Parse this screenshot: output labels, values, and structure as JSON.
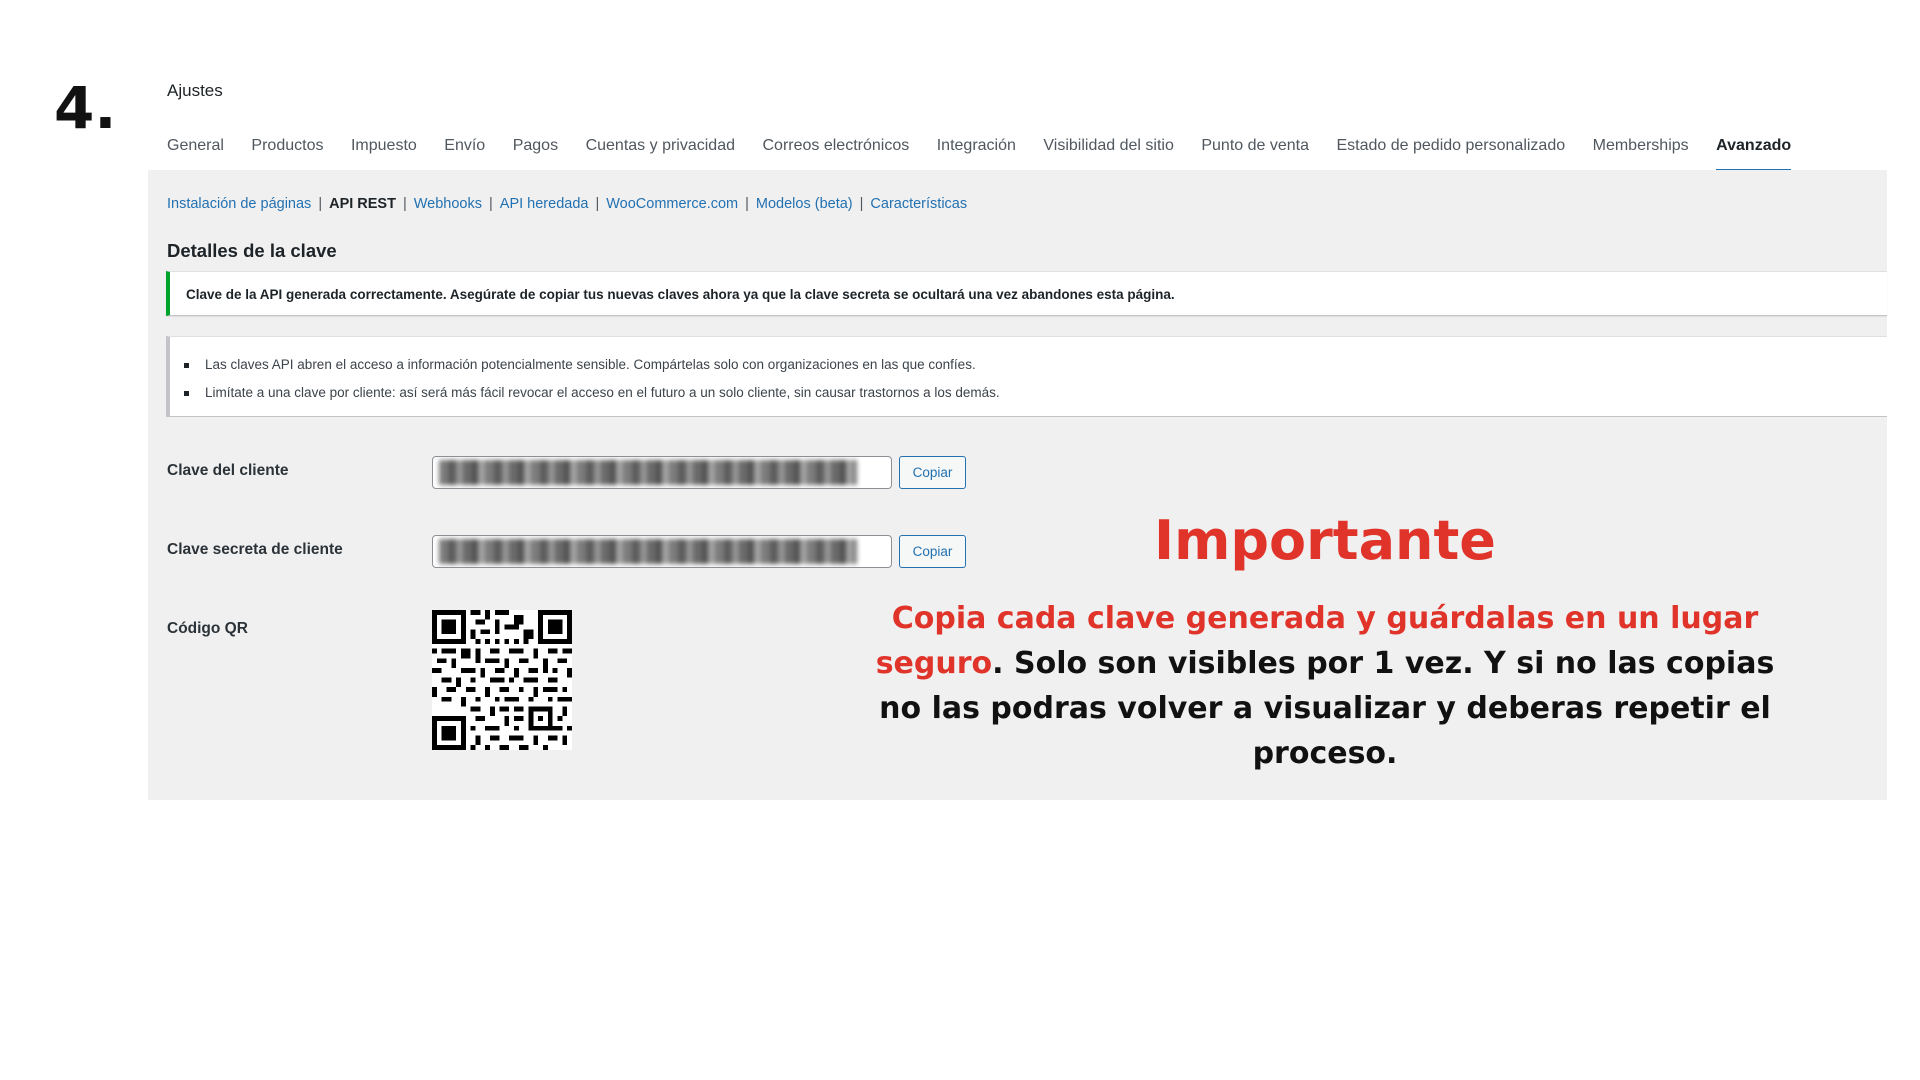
{
  "step_label": "4.",
  "page_title": "Ajustes",
  "tabs": [
    {
      "label": "General",
      "active": false
    },
    {
      "label": "Productos",
      "active": false
    },
    {
      "label": "Impuesto",
      "active": false
    },
    {
      "label": "Envío",
      "active": false
    },
    {
      "label": "Pagos",
      "active": false
    },
    {
      "label": "Cuentas y privacidad",
      "active": false
    },
    {
      "label": "Correos electrónicos",
      "active": false
    },
    {
      "label": "Integración",
      "active": false
    },
    {
      "label": "Visibilidad del sitio",
      "active": false
    },
    {
      "label": "Punto de venta",
      "active": false
    },
    {
      "label": "Estado de pedido personalizado",
      "active": false
    },
    {
      "label": "Memberships",
      "active": false
    },
    {
      "label": "Avanzado",
      "active": true
    }
  ],
  "subnav": [
    {
      "label": "Instalación de páginas",
      "current": false
    },
    {
      "label": "API REST",
      "current": true
    },
    {
      "label": "Webhooks",
      "current": false
    },
    {
      "label": "API heredada",
      "current": false
    },
    {
      "label": "WooCommerce.com",
      "current": false
    },
    {
      "label": "Modelos (beta)",
      "current": false
    },
    {
      "label": "Características",
      "current": false
    }
  ],
  "section_title": "Detalles de la clave",
  "success_notice": "Clave de la API generada correctamente. Asegúrate de copiar tus nuevas claves ahora ya que la clave secreta se ocultará una vez abandones esta página.",
  "info_notice": [
    "Las claves API abren el acceso a información potencialmente sensible. Compártelas solo con organizaciones en las que confíes.",
    "Limítate a una clave por cliente: así será más fácil revocar el acceso en el futuro a un solo cliente, sin causar trastornos a los demás."
  ],
  "fields": {
    "consumer_key_label": "Clave del cliente",
    "consumer_secret_label": "Clave secreta de cliente",
    "qr_label": "Código QR",
    "copy_label": "Copiar"
  },
  "overlay": {
    "headline": "Importante",
    "line_red": "Copia cada clave generada y guárdalas en un lugar seguro",
    "line_red_end": ".",
    "line_black": "Solo son visibles por 1 vez. Y si no las copias no las podras volver a visualizar y deberas repetir el proceso."
  },
  "colors": {
    "accent_blue": "#2271b1",
    "success_green": "#00a32a",
    "highlight_red": "#e0342a",
    "panel_bg": "#f0f0f1"
  }
}
